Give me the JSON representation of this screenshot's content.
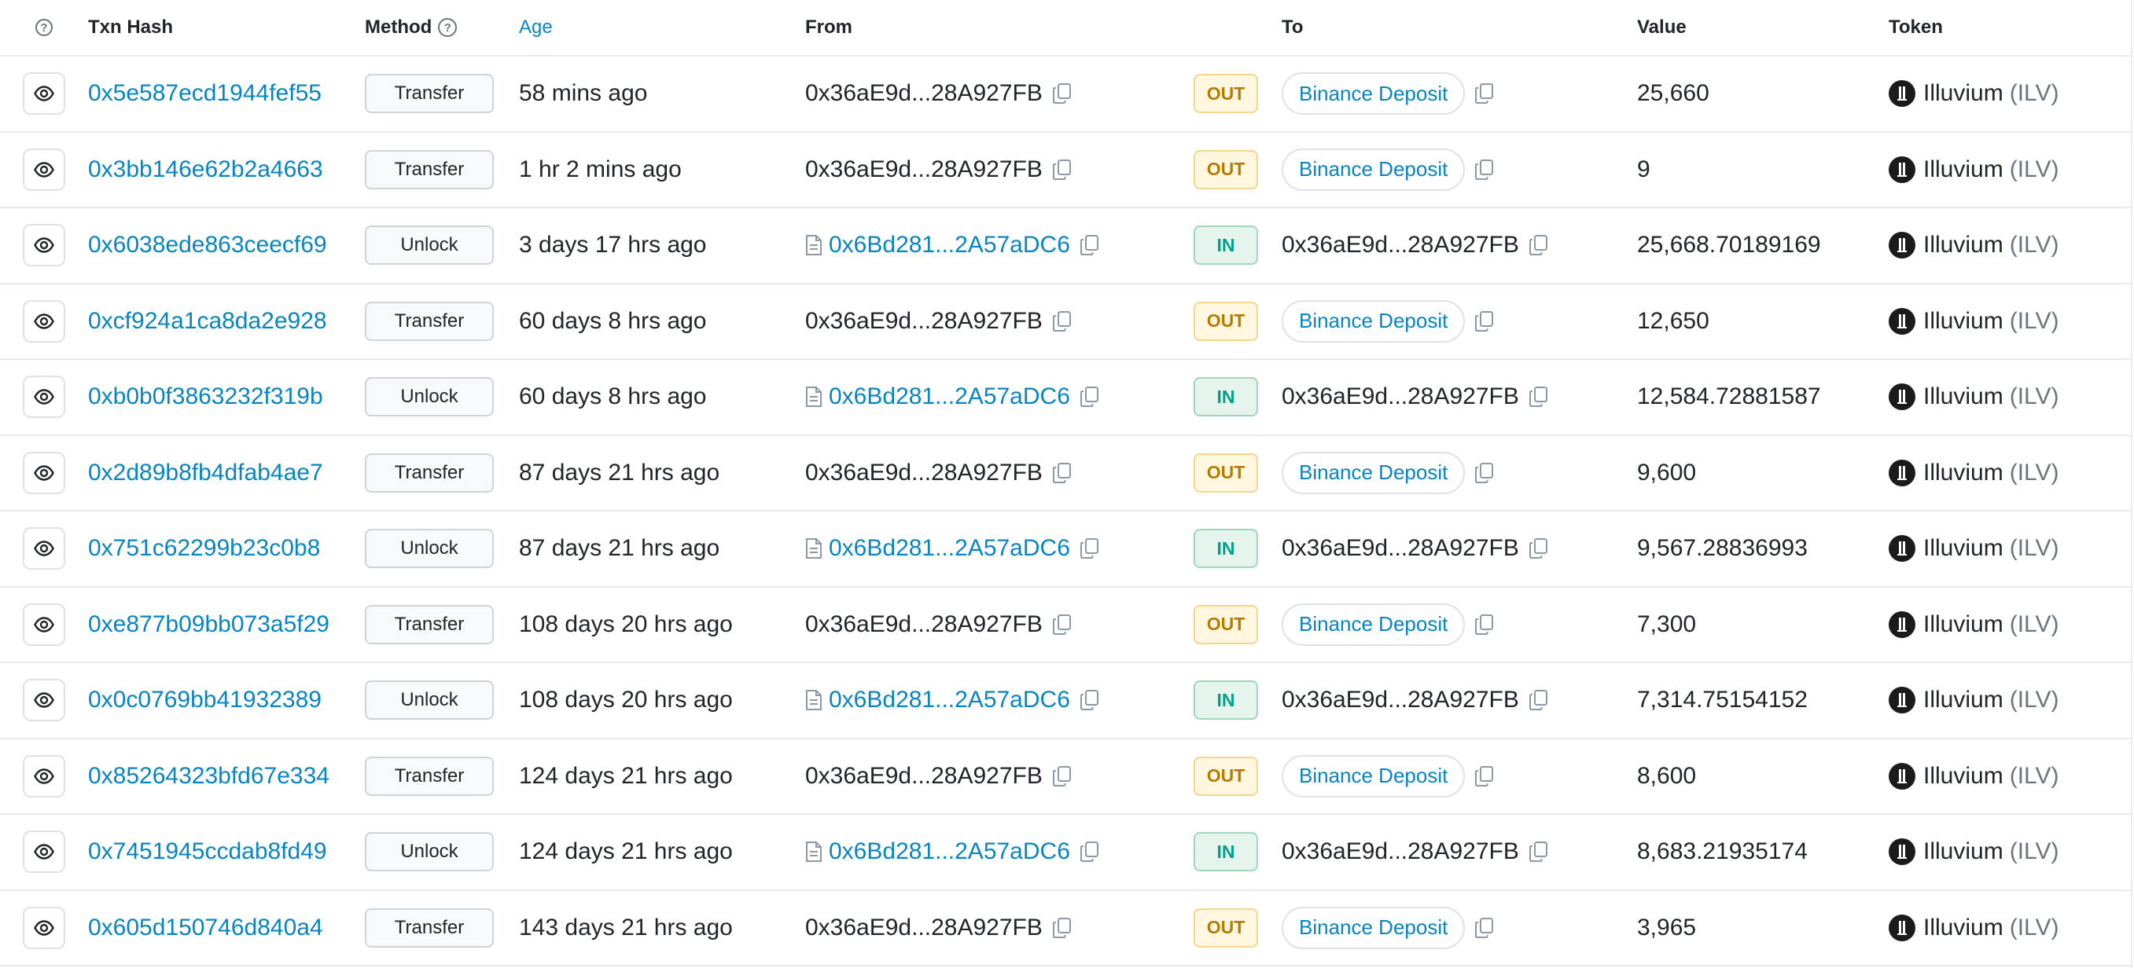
{
  "colors": {
    "link": "#0784c3",
    "out_badge_text": "#b47d00",
    "out_badge_bg": "#fff7e0",
    "in_badge_text": "#00a186",
    "in_badge_bg": "#e5f5ee",
    "border": "#e9ecef"
  },
  "header": {
    "help": "?",
    "txn_hash": "Txn Hash",
    "method": "Method",
    "age": "Age",
    "from": "From",
    "to": "To",
    "value": "Value",
    "token": "Token"
  },
  "rows": [
    {
      "hash": "0x5e587ecd1944fef55",
      "method": "Transfer",
      "age": "58 mins ago",
      "from": "0x36aE9d...28A927FB",
      "from_contract": false,
      "direction": "OUT",
      "to": "Binance Deposit",
      "to_pill": true,
      "value": "25,660",
      "token_name": "Illuvium",
      "token_symbol": "(ILV)"
    },
    {
      "hash": "0x3bb146e62b2a4663",
      "method": "Transfer",
      "age": "1 hr 2 mins ago",
      "from": "0x36aE9d...28A927FB",
      "from_contract": false,
      "direction": "OUT",
      "to": "Binance Deposit",
      "to_pill": true,
      "value": "9",
      "token_name": "Illuvium",
      "token_symbol": "(ILV)"
    },
    {
      "hash": "0x6038ede863ceecf69",
      "method": "Unlock",
      "age": "3 days 17 hrs ago",
      "from": "0x6Bd281...2A57aDC6",
      "from_contract": true,
      "direction": "IN",
      "to": "0x36aE9d...28A927FB",
      "to_pill": false,
      "value": "25,668.70189169",
      "token_name": "Illuvium",
      "token_symbol": "(ILV)"
    },
    {
      "hash": "0xcf924a1ca8da2e928",
      "method": "Transfer",
      "age": "60 days 8 hrs ago",
      "from": "0x36aE9d...28A927FB",
      "from_contract": false,
      "direction": "OUT",
      "to": "Binance Deposit",
      "to_pill": true,
      "value": "12,650",
      "token_name": "Illuvium",
      "token_symbol": "(ILV)"
    },
    {
      "hash": "0xb0b0f3863232f319b",
      "method": "Unlock",
      "age": "60 days 8 hrs ago",
      "from": "0x6Bd281...2A57aDC6",
      "from_contract": true,
      "direction": "IN",
      "to": "0x36aE9d...28A927FB",
      "to_pill": false,
      "value": "12,584.72881587",
      "token_name": "Illuvium",
      "token_symbol": "(ILV)"
    },
    {
      "hash": "0x2d89b8fb4dfab4ae7",
      "method": "Transfer",
      "age": "87 days 21 hrs ago",
      "from": "0x36aE9d...28A927FB",
      "from_contract": false,
      "direction": "OUT",
      "to": "Binance Deposit",
      "to_pill": true,
      "value": "9,600",
      "token_name": "Illuvium",
      "token_symbol": "(ILV)"
    },
    {
      "hash": "0x751c62299b23c0b8",
      "method": "Unlock",
      "age": "87 days 21 hrs ago",
      "from": "0x6Bd281...2A57aDC6",
      "from_contract": true,
      "direction": "IN",
      "to": "0x36aE9d...28A927FB",
      "to_pill": false,
      "value": "9,567.28836993",
      "token_name": "Illuvium",
      "token_symbol": "(ILV)"
    },
    {
      "hash": "0xe877b09bb073a5f29",
      "method": "Transfer",
      "age": "108 days 20 hrs ago",
      "from": "0x36aE9d...28A927FB",
      "from_contract": false,
      "direction": "OUT",
      "to": "Binance Deposit",
      "to_pill": true,
      "value": "7,300",
      "token_name": "Illuvium",
      "token_symbol": "(ILV)"
    },
    {
      "hash": "0x0c0769bb41932389",
      "method": "Unlock",
      "age": "108 days 20 hrs ago",
      "from": "0x6Bd281...2A57aDC6",
      "from_contract": true,
      "direction": "IN",
      "to": "0x36aE9d...28A927FB",
      "to_pill": false,
      "value": "7,314.75154152",
      "token_name": "Illuvium",
      "token_symbol": "(ILV)"
    },
    {
      "hash": "0x85264323bfd67e334",
      "method": "Transfer",
      "age": "124 days 21 hrs ago",
      "from": "0x36aE9d...28A927FB",
      "from_contract": false,
      "direction": "OUT",
      "to": "Binance Deposit",
      "to_pill": true,
      "value": "8,600",
      "token_name": "Illuvium",
      "token_symbol": "(ILV)"
    },
    {
      "hash": "0x7451945ccdab8fd49",
      "method": "Unlock",
      "age": "124 days 21 hrs ago",
      "from": "0x6Bd281...2A57aDC6",
      "from_contract": true,
      "direction": "IN",
      "to": "0x36aE9d...28A927FB",
      "to_pill": false,
      "value": "8,683.21935174",
      "token_name": "Illuvium",
      "token_symbol": "(ILV)"
    },
    {
      "hash": "0x605d150746d840a4",
      "method": "Transfer",
      "age": "143 days 21 hrs ago",
      "from": "0x36aE9d...28A927FB",
      "from_contract": false,
      "direction": "OUT",
      "to": "Binance Deposit",
      "to_pill": true,
      "value": "3,965",
      "token_name": "Illuvium",
      "token_symbol": "(ILV)"
    }
  ]
}
